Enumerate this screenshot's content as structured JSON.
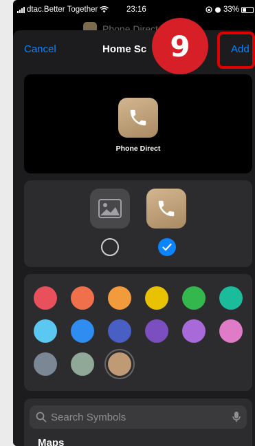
{
  "status_bar": {
    "carrier": "dtac.Better Together",
    "time": "23:16",
    "battery": "33%"
  },
  "background": {
    "title": "Phone Direct"
  },
  "nav": {
    "cancel": "Cancel",
    "title": "Home Sc",
    "add": "Add"
  },
  "step_badge": "9",
  "preview": {
    "app_name": "Phone Direct",
    "icon": "phone-icon"
  },
  "icon_choice": {
    "options": [
      {
        "icon": "photo-icon",
        "selected": false
      },
      {
        "icon": "phone-icon",
        "selected": true
      }
    ]
  },
  "colors": [
    {
      "hex": "#e8505b",
      "selected": false
    },
    {
      "hex": "#f0704c",
      "selected": false
    },
    {
      "hex": "#f29b3c",
      "selected": false
    },
    {
      "hex": "#e8c200",
      "selected": false
    },
    {
      "hex": "#34b84e",
      "selected": false
    },
    {
      "hex": "#1abc9c",
      "selected": false
    },
    {
      "hex": "#5ac8f0",
      "selected": false
    },
    {
      "hex": "#2f8cf0",
      "selected": false
    },
    {
      "hex": "#4a5fc4",
      "selected": false
    },
    {
      "hex": "#7b4fbf",
      "selected": false
    },
    {
      "hex": "#a86ad8",
      "selected": false
    },
    {
      "hex": "#e07bc8",
      "selected": false
    },
    {
      "hex": "#7b8794",
      "selected": false
    },
    {
      "hex": "#8fa898",
      "selected": false
    },
    {
      "hex": "#bf9a74",
      "selected": true
    }
  ],
  "search": {
    "placeholder": "Search Symbols"
  },
  "section": {
    "label": "Maps"
  }
}
